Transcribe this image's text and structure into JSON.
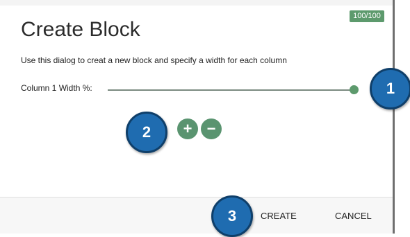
{
  "dialog": {
    "counter": "100/100",
    "title": "Create Block",
    "description": "Use this dialog to creat a new block and specify a width for each column",
    "column_label": "Column 1 Width %:",
    "column_width_value": 100,
    "add_symbol": "+",
    "remove_symbol": "−",
    "create_label": "CREATE",
    "cancel_label": "CANCEL"
  },
  "callouts": [
    "1",
    "2",
    "3"
  ],
  "colors": {
    "accent_green": "#5d9a6d",
    "callout_blue": "#1f6cb0"
  }
}
